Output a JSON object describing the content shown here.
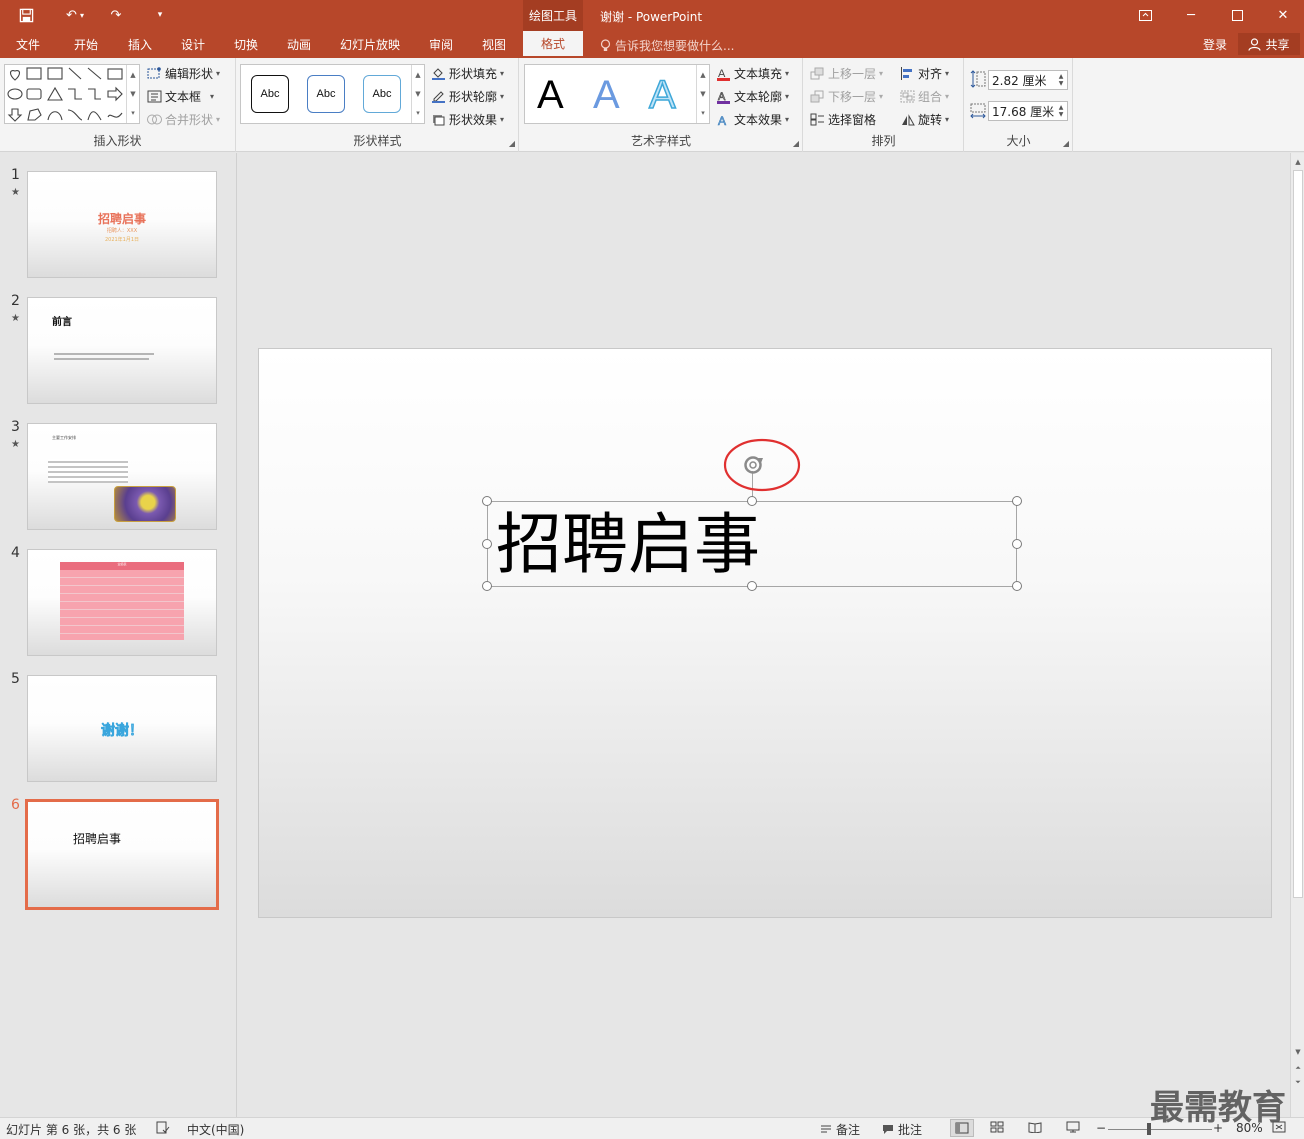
{
  "titlebar": {
    "contextual_header": "绘图工具",
    "window_title": "谢谢 - PowerPoint"
  },
  "tabs": {
    "items": [
      "文件",
      "开始",
      "插入",
      "设计",
      "切换",
      "动画",
      "幻灯片放映",
      "审阅",
      "视图"
    ],
    "active": "格式",
    "tell_me": "告诉我您想要做什么...",
    "login": "登录",
    "share": "共享"
  },
  "ribbon": {
    "insert_shapes": {
      "label": "插入形状",
      "edit_shape": "编辑形状",
      "text_box": "文本框",
      "merge_shapes": "合并形状"
    },
    "shape_styles": {
      "label": "形状样式",
      "swatch_text": "Abc",
      "fill": "形状填充",
      "outline": "形状轮廓",
      "effects": "形状效果"
    },
    "wordart": {
      "label": "艺术字样式",
      "glyph": "A",
      "text_fill": "文本填充",
      "text_outline": "文本轮廓",
      "text_effects": "文本效果"
    },
    "arrange": {
      "label": "排列",
      "bring_forward": "上移一层",
      "send_backward": "下移一层",
      "selection_pane": "选择窗格",
      "align": "对齐",
      "group": "组合",
      "rotate": "旋转"
    },
    "size": {
      "label": "大小",
      "height": "2.82 厘米",
      "width": "17.68 厘米"
    }
  },
  "slides": [
    {
      "num": "1",
      "star": "★",
      "title": "招聘启事",
      "sub1": "招聘人：XXX",
      "sub2": "2021年1月1日"
    },
    {
      "num": "2",
      "star": "★",
      "title": "前言"
    },
    {
      "num": "3",
      "star": "★",
      "title": "主要工作安排"
    },
    {
      "num": "4",
      "title": "业绩表"
    },
    {
      "num": "5",
      "title": "谢谢！"
    },
    {
      "num": "6",
      "title": "招聘启事"
    }
  ],
  "canvas": {
    "title_text": "招聘启事"
  },
  "status": {
    "slide_info": "幻灯片 第 6 张，共 6 张",
    "language": "中文(中国)",
    "notes": "备注",
    "comments": "批注",
    "zoom": "80%"
  },
  "watermark": "最需教育",
  "colors": {
    "accent": "#b7472a",
    "selected_border": "#e46c4a",
    "annotation_red": "#e03030"
  }
}
